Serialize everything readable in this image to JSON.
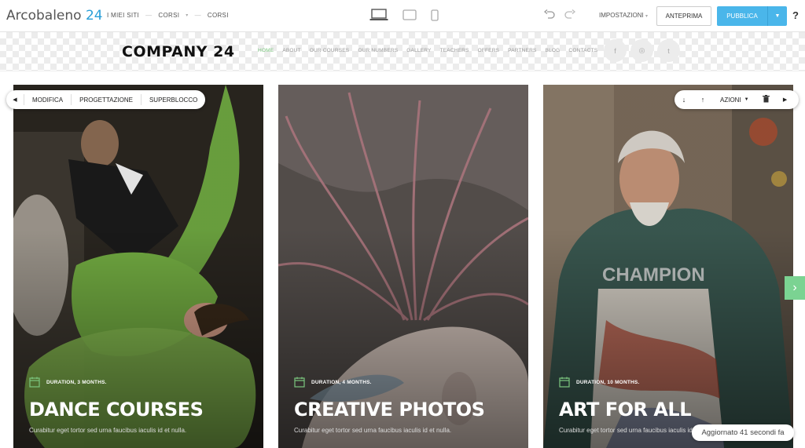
{
  "editor": {
    "brand_name": "Arcobaleno",
    "brand_number": "24",
    "breadcrumbs": [
      "I MIEI SITI",
      "CORSI",
      "CORSI"
    ],
    "devices": [
      "desktop",
      "tablet",
      "mobile"
    ],
    "settings_label": "IMPOSTAZIONI",
    "preview_label": "ANTEPRIMA",
    "publish_label": "PUBBLICA",
    "help_label": "?",
    "accent_color": "#4ab6ea"
  },
  "site": {
    "logo": "COMPANY 24",
    "nav": [
      "HOME",
      "ABOUT",
      "OUR COURSES",
      "OUR NUMBERS",
      "GALLERY",
      "TEACHERS",
      "OFFERS",
      "PARTNERS",
      "BLOG",
      "CONTACTS"
    ],
    "active_nav": "HOME",
    "socials": [
      "f",
      "◎",
      "t"
    ],
    "nav_active_color": "#7bc67e"
  },
  "block_toolbar": {
    "items": [
      "MODIFICA",
      "PROGETTAZIONE",
      "SUPERBLOCCO"
    ]
  },
  "actions_toolbar": {
    "label": "AZIONI"
  },
  "cards": [
    {
      "meta": "DURATION, 3 MONTHS.",
      "title": "DANCE COURSES",
      "desc": "Curabitur eget tortor sed urna faucibus iaculis id et nulla."
    },
    {
      "meta": "DURATION, 4 MONTHS.",
      "title": "CREATIVE PHOTOS",
      "desc": "Curabitur eget tortor sed urna faucibus iaculis id et nulla."
    },
    {
      "meta": "DURATION, 10 MONTHS.",
      "title": "ART FOR ALL",
      "desc": "Curabitur eget tortor sed urna faucibus iaculis id et nulla."
    }
  ],
  "toast": "Aggiornato 41 secondi fa"
}
